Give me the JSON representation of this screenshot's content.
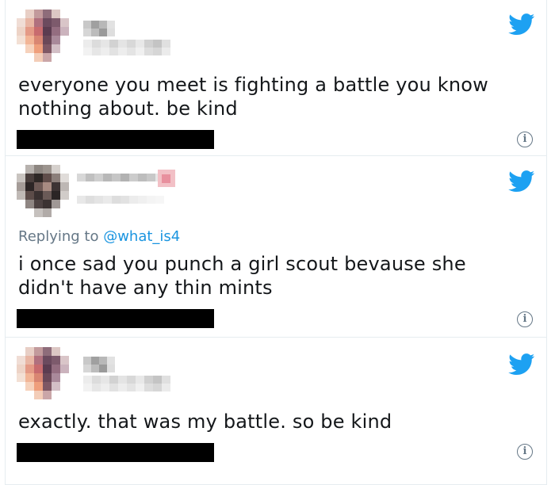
{
  "tweets": [
    {
      "reply_prefix": "",
      "reply_handle": "",
      "text": "everyone you meet is fighting a battle you know nothing about. be kind"
    },
    {
      "reply_prefix": "Replying to ",
      "reply_handle": "@what_is4",
      "text": "i once sad you punch a girl scout bevause she didn't have any thin mints"
    },
    {
      "reply_prefix": "",
      "reply_handle": "",
      "text": "exactly. that was my battle. so be kind"
    }
  ],
  "icons": {
    "platform": "twitter-bird-icon",
    "info": "info-icon"
  },
  "colors": {
    "brand": "#1da1f2",
    "reply_handle": "#1b95e0",
    "meta_text": "#657786",
    "border": "#e6ecf0",
    "redaction": "#000000"
  }
}
